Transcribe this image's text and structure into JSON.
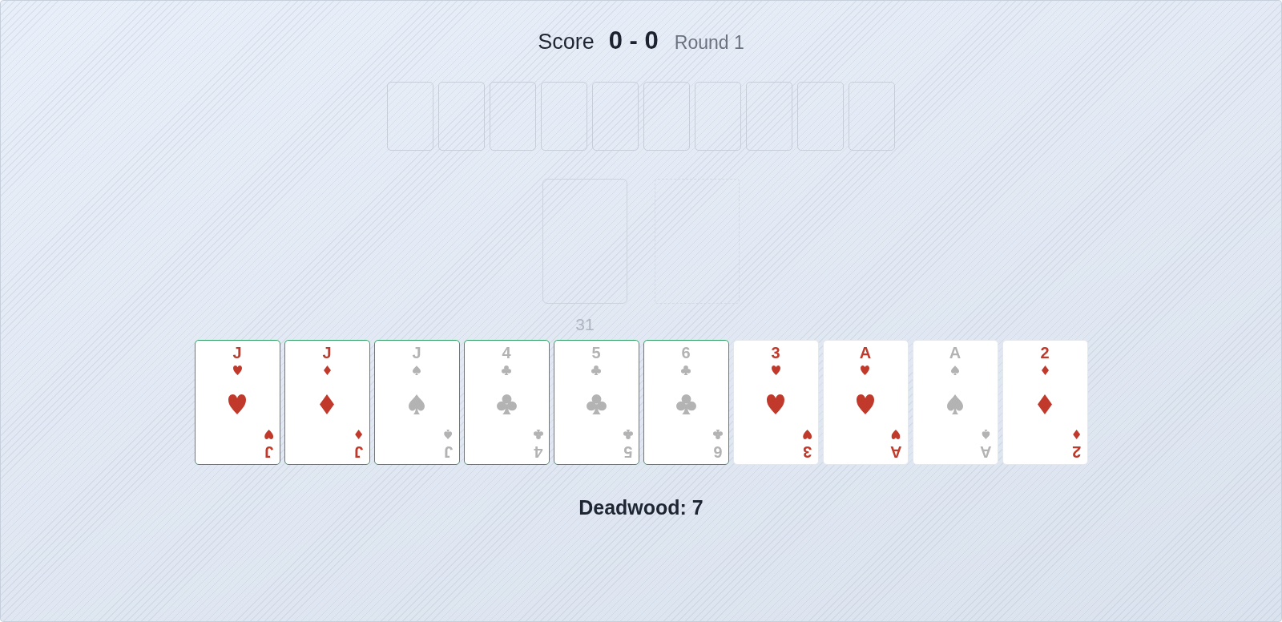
{
  "scoreboard": {
    "label": "Score",
    "score": "0 - 0",
    "round": "Round 1"
  },
  "opponent_hand": [
    {
      "kind": "back"
    },
    {
      "kind": "back"
    },
    {
      "kind": "back"
    },
    {
      "kind": "back"
    },
    {
      "kind": "back"
    },
    {
      "kind": "back"
    },
    {
      "kind": "back"
    },
    {
      "kind": "back"
    },
    {
      "kind": "back"
    },
    {
      "kind": "back"
    }
  ],
  "stock": {
    "kind": "back",
    "count": "31"
  },
  "discard": {
    "kind": "empty"
  },
  "hand": [
    {
      "rank": "J",
      "rank_rotated": "J",
      "kind": "hearts",
      "melded": true
    },
    {
      "rank": "J",
      "rank_rotated": "J",
      "kind": "diamonds",
      "melded": true
    },
    {
      "rank": "J",
      "rank_rotated": "J",
      "kind": "spades",
      "melded": true
    },
    {
      "rank": "4",
      "rank_rotated": "4",
      "kind": "clubs",
      "melded": true
    },
    {
      "rank": "5",
      "rank_rotated": "5",
      "kind": "clubs",
      "melded": true
    },
    {
      "rank": "6",
      "rank_rotated": "6",
      "kind": "clubs",
      "melded": true
    },
    {
      "rank": "3",
      "rank_rotated": "3",
      "kind": "hearts",
      "melded": false
    },
    {
      "rank": "A",
      "rank_rotated": "A",
      "kind": "hearts",
      "melded": false
    },
    {
      "rank": "A",
      "rank_rotated": "A",
      "kind": "spades",
      "melded": false
    },
    {
      "rank": "2",
      "rank_rotated": "2",
      "kind": "diamonds",
      "melded": false
    }
  ],
  "deadwood": "Deadwood: 7"
}
